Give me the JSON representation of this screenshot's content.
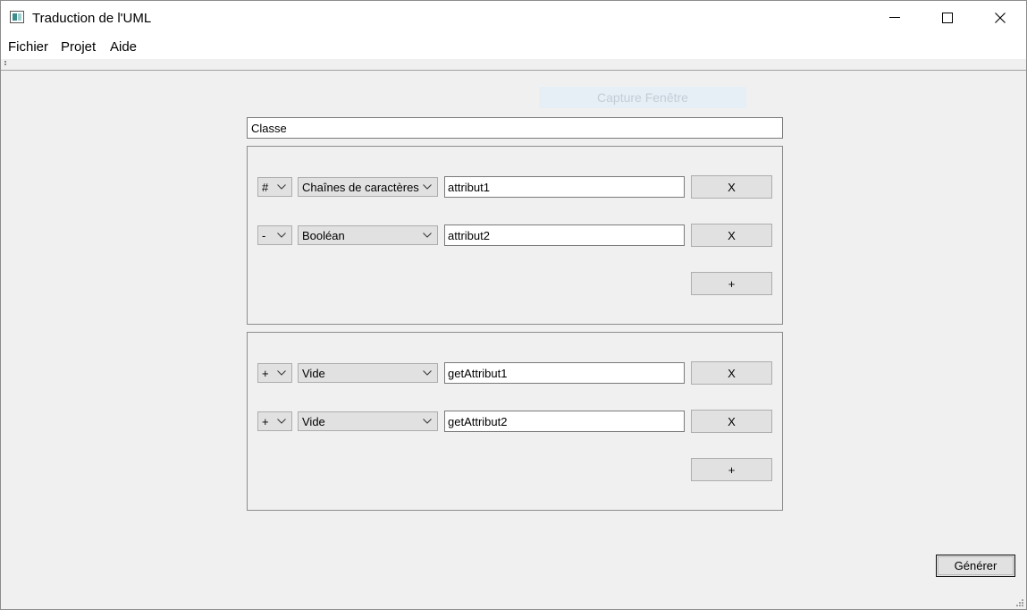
{
  "window": {
    "title": "Traduction de l'UML",
    "controls": {
      "minimize_icon": "minimize-icon",
      "maximize_icon": "maximize-icon",
      "close_icon": "close-icon"
    }
  },
  "menu": {
    "items": [
      "Fichier",
      "Projet",
      "Aide"
    ]
  },
  "overlay": {
    "capture_label": "Capture Fenêtre"
  },
  "class_name": {
    "value": "Classe"
  },
  "attributes": {
    "rows": [
      {
        "visibility": "#",
        "type": "Chaînes de caractères",
        "name": "attribut1",
        "delete_label": "X"
      },
      {
        "visibility": "-",
        "type": "Booléan",
        "name": "attribut2",
        "delete_label": "X"
      }
    ],
    "add_label": "+"
  },
  "methods": {
    "rows": [
      {
        "visibility": "+",
        "type": "Vide",
        "name": "getAttribut1",
        "delete_label": "X"
      },
      {
        "visibility": "+",
        "type": "Vide",
        "name": "getAttribut2",
        "delete_label": "X"
      }
    ],
    "add_label": "+"
  },
  "footer": {
    "generate_label": "Générer"
  },
  "colors": {
    "background": "#f0f0f0",
    "button": "#e1e1e1",
    "border": "#adadad"
  }
}
